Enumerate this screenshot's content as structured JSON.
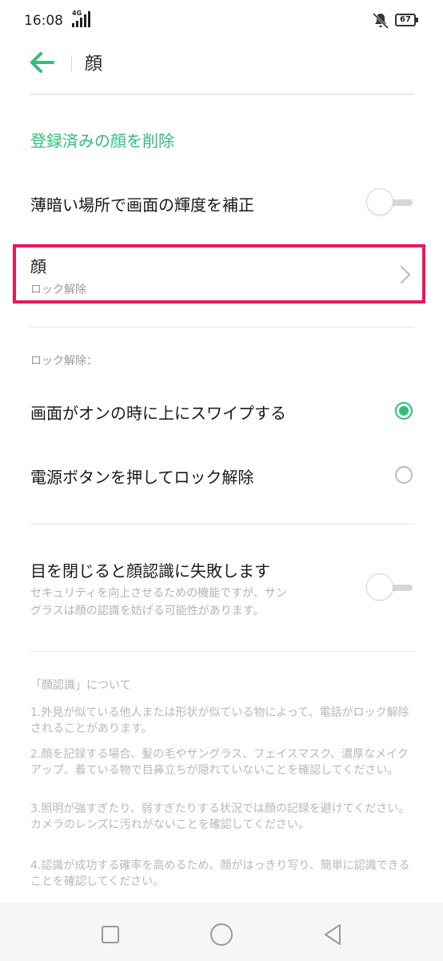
{
  "status": {
    "time": "16:08",
    "network": "4G",
    "battery": "67"
  },
  "header": {
    "title": "顔"
  },
  "face_settings": {
    "delete_label": "登録済みの顔を削除",
    "low_light_label": "薄暗い場所で画面の輝度を補正",
    "low_light_on": false,
    "face_item_title": "顔",
    "face_item_subtitle": "ロック解除"
  },
  "unlock": {
    "section_label": "ロック解除：",
    "options": [
      {
        "label": "画面がオンの時に上にスワイプする",
        "selected": true
      },
      {
        "label": "電源ボタンを押してロック解除",
        "selected": false
      }
    ]
  },
  "eyes": {
    "label": "目を閉じると顔認識に失敗します",
    "desc_line1": "セキュリティを向上させるための機能ですが、サン",
    "desc_line2": "グラスは顔の認識を妨げる可能性があります。",
    "on": false
  },
  "about": {
    "title": "「顔認識」について",
    "notes": [
      "1.外見が似ている他人または形状が似ている物によって、電話がロック解除されることがあります。",
      "2.顔を記録する場合、髪の毛やサングラス、フェイスマスク、濃厚なメイクアップ、着ている物で目鼻立ちが隠れていないことを確認してください。",
      "3.照明が強すぎたり、弱すぎたりする状況では顔の記録を避けてください。カメラのレンズに汚れがないことを確認してください。",
      "4.認識が成功する確率を高めるため、顔がはっきり写り、簡単に認識できることを確認してください。"
    ]
  },
  "colors": {
    "accent": "#2fbf7a",
    "highlight": "#e8175d"
  },
  "icons": {
    "back": "back-arrow-icon",
    "chevron": "chevron-right-icon",
    "bell": "bell-muted-icon",
    "nav": [
      "square-icon",
      "circle-icon",
      "triangle-back-icon"
    ]
  }
}
